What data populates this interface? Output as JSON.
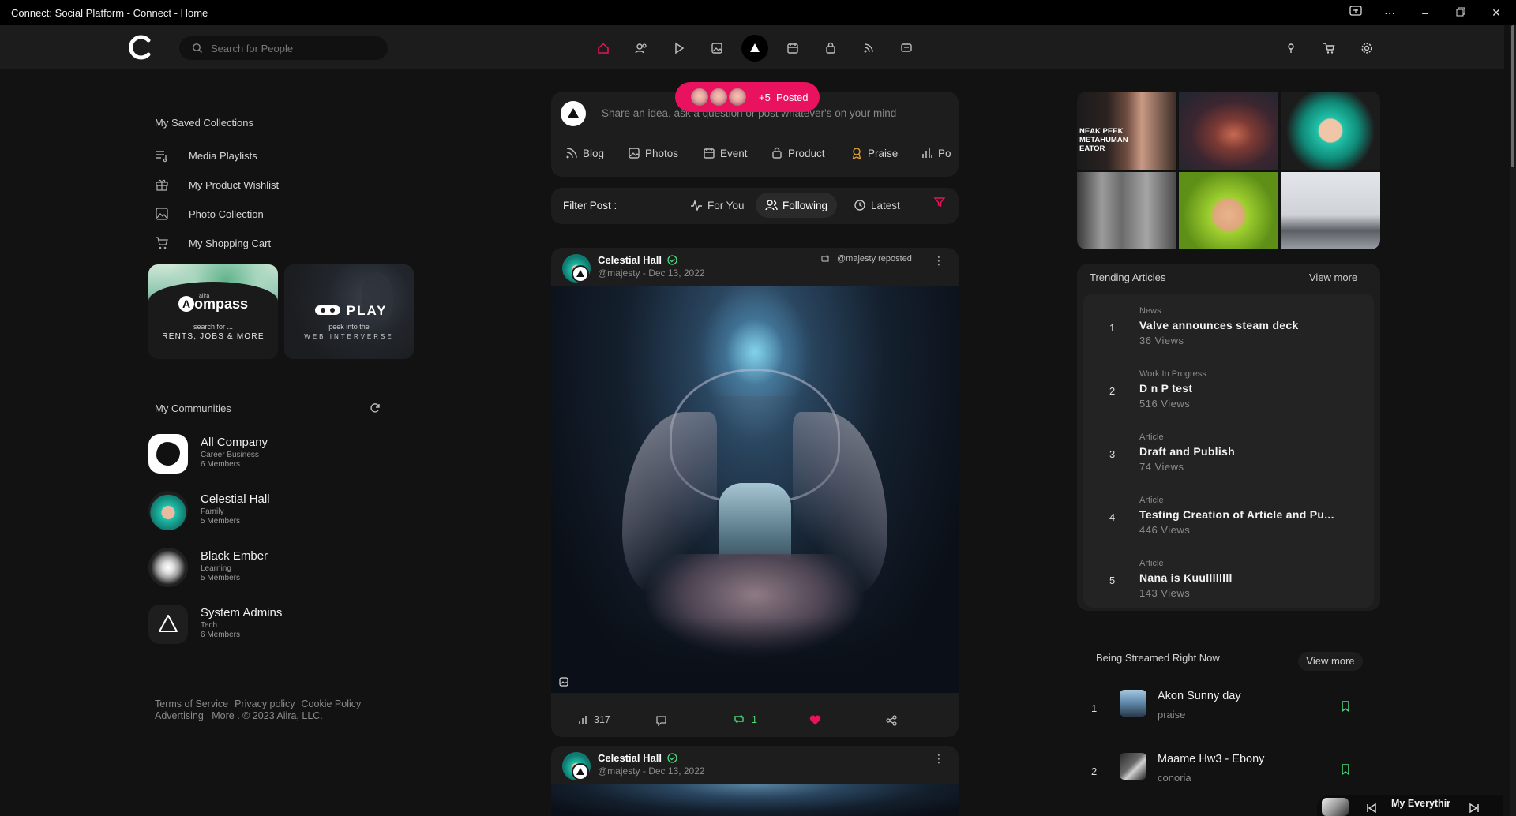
{
  "window": {
    "title": "Connect: Social Platform - Connect - Home"
  },
  "search": {
    "placeholder": "Search for People"
  },
  "left": {
    "saved_title": "My Saved Collections",
    "saved": [
      {
        "label": "Media Playlists",
        "icon": "playlist-icon"
      },
      {
        "label": "My Product Wishlist",
        "icon": "gift-icon"
      },
      {
        "label": "Photo Collection",
        "icon": "image-icon"
      },
      {
        "label": "My Shopping Cart",
        "icon": "cart-icon"
      }
    ],
    "promo1": {
      "brand_prefix": "aiira",
      "brand": "ompass",
      "line1": "search for ...",
      "line2": "RENTS, JOBS & MORE"
    },
    "promo2": {
      "brand": "PLAY",
      "line1": "peek into the",
      "line2": "WEB INTERVERSE"
    },
    "communities_title": "My Communities",
    "communities": [
      {
        "name": "All Company",
        "category": "Career Business",
        "members": "6 Members"
      },
      {
        "name": "Celestial Hall",
        "category": "Family",
        "members": "5 Members"
      },
      {
        "name": "Black Ember",
        "category": "Learning",
        "members": "5 Members"
      },
      {
        "name": "System Admins",
        "category": "Tech",
        "members": "6 Members"
      }
    ],
    "footer_line1": [
      "Terms of Service",
      "Privacy policy",
      "Cookie Policy"
    ],
    "footer_line2": "Advertising   More . © 2023 Aiira, LLC."
  },
  "composer": {
    "placeholder": "Share an idea, ask a question or post whatever's on your mind",
    "tabs": [
      "Blog",
      "Photos",
      "Event",
      "Product",
      "Praise",
      "Po"
    ],
    "posted_pill": "+5  Posted"
  },
  "filter": {
    "label": "Filter Post :",
    "options": [
      "For You",
      "Following",
      "Latest"
    ],
    "active": "Following"
  },
  "posts": [
    {
      "name": "Celestial Hall",
      "handle": "@majesty - Dec 13, 2022",
      "repost": "@majesty reposted",
      "views": "317",
      "reposts": "1"
    },
    {
      "name": "Celestial Hall",
      "handle": "@majesty - Dec 13, 2022"
    }
  ],
  "gallery": {
    "tile1_text": "NEAK PEEK METAHUMAN EATOR"
  },
  "trending": {
    "title": "Trending Articles",
    "view_more": "View more",
    "items": [
      {
        "num": "1",
        "category": "News",
        "title": "Valve announces steam deck",
        "views": "36 Views"
      },
      {
        "num": "2",
        "category": "Work In Progress",
        "title": "D n P test",
        "views": "516 Views"
      },
      {
        "num": "3",
        "category": "Article",
        "title": "Draft and Publish",
        "views": "74 Views"
      },
      {
        "num": "4",
        "category": "Article",
        "title": "Testing Creation of Article and Pu...",
        "views": "446 Views"
      },
      {
        "num": "5",
        "category": "Article",
        "title": "Nana is Kuullllllll",
        "views": "143 Views"
      }
    ]
  },
  "streams": {
    "title": "Being Streamed Right Now",
    "view_more": "View more",
    "items": [
      {
        "num": "1",
        "title": "Akon Sunny day",
        "artist": "praise"
      },
      {
        "num": "2",
        "title": "Maame Hw3 - Ebony",
        "artist": "conoria"
      }
    ]
  },
  "mini_player": {
    "title": "My Everythir"
  },
  "colors": {
    "accent": "#e8125f",
    "bg": "#121212",
    "card": "#1d1d1d",
    "green": "#4ad97a"
  }
}
